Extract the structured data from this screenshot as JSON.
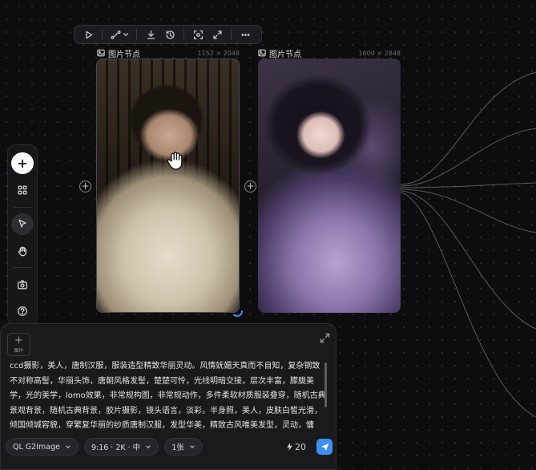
{
  "toolbar": {
    "buttons": [
      "play-icon",
      "branch-icon",
      "download-icon",
      "history-icon",
      "screenshot-icon",
      "fullscreen-icon",
      "more-icon"
    ]
  },
  "nodes": [
    {
      "title": "图片节点",
      "dims": "1152 × 2048"
    },
    {
      "title": "图片节点",
      "dims": "1600 × 2848"
    }
  ],
  "tools": {
    "items": [
      "add-icon",
      "grid-icon",
      "pointer-icon",
      "hand-icon",
      "camera-icon",
      "help-icon"
    ]
  },
  "composer": {
    "attach_label": "图片",
    "attach_plus": "+",
    "prompt": "ccd摄影，美人，唐制汉服，服装造型精致华丽灵动。风情妩媚天真而不自知，复杂钢致不对称高髻，华丽头饰，唐朝风格发髻，楚楚可怜，光线明暗交接，层次丰富，朦胧美学，光的美学，lomo效果，非常规构图，非常规动作，多件柔软材质服装叠穿，随机古典景观背景，随机古典背景，胶片摄影，镜头语言，淡彩，半身照，美人，皮肤白皙光滑，倾国倾城容貌，穿繁复华丽的纱质唐制汉服，发型华美，精致古风唯美发型，灵动，慵懒，古风感精致妆容，整体画面质感细腻通透，色彩雅致温柔，氛围静谧梦幻"
  },
  "controls": {
    "model": "QL G2Image",
    "ratio": "9:16 · 2K · 中",
    "count": "1张",
    "credits": "20"
  }
}
